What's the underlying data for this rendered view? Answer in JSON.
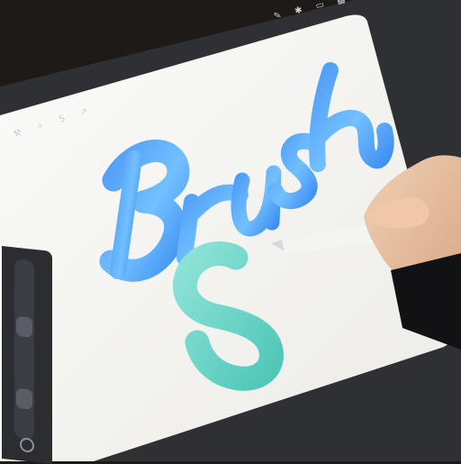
{
  "scene": {
    "description": "",
    "lettering": {
      "top_word": "Brush",
      "bottom_letter": "S"
    },
    "colors": {
      "frame": "#1d1a18",
      "screen": "#f7f7f4",
      "blue_light": "#76c7ff",
      "blue_dark": "#3f8ff3",
      "mint": "#79d7c9",
      "mint_dark": "#4fc7b8",
      "skin": "#e8c3a1",
      "pencil": "#f2f2f0"
    }
  },
  "ui": {
    "top_toolbar": {
      "icons": [
        "brush-icon",
        "smudge-icon",
        "eraser-icon",
        "layers-icon",
        "color-icon"
      ]
    },
    "left_toolbar": {
      "icons": [
        "wrench-icon",
        "magic-wand-icon",
        "selection-icon",
        "transform-icon"
      ]
    }
  }
}
